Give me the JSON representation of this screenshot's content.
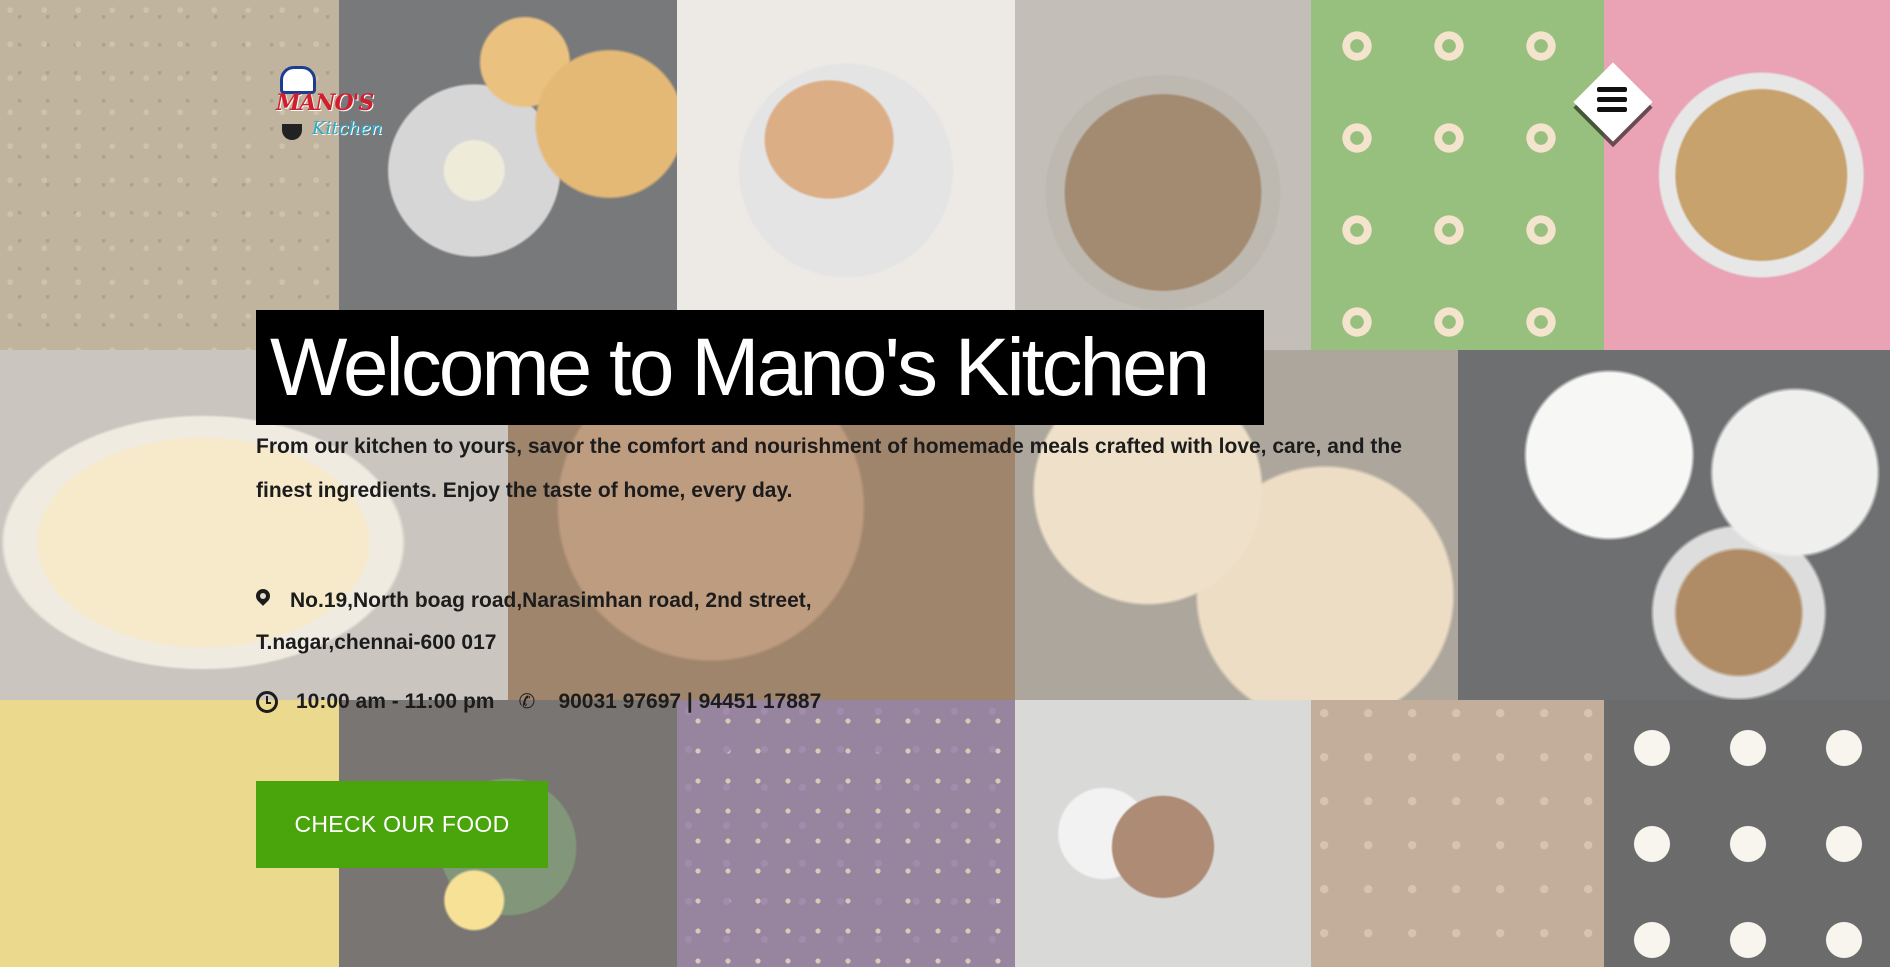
{
  "logo": {
    "brand": "MANO'S",
    "subtitle": "Kitchen"
  },
  "menu": {
    "icon": "hamburger-menu-icon"
  },
  "hero": {
    "title": "Welcome to Mano's Kitchen",
    "description": "From our kitchen to yours, savor the comfort and nourishment of homemade meals crafted with love, care, and the finest ingredients. Enjoy the taste of home, every day."
  },
  "contact": {
    "address": "No.19,North boag road,Narasimhan road, 2nd street, T.nagar,chennai-600 017",
    "hours": "10:00 am - 11:00 pm",
    "phone": "90031 97697 | 94451 17887"
  },
  "cta": {
    "label": "CHECK OUR FOOD"
  },
  "colors": {
    "accent": "#4aa50c",
    "title_bg": "#000000",
    "text": "#1c1c1c"
  }
}
